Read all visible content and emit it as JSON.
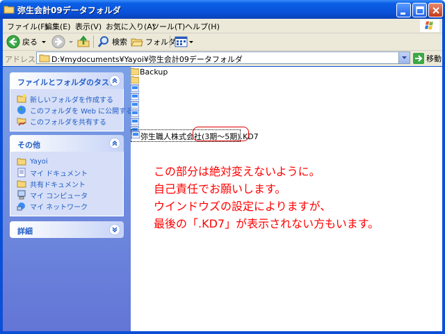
{
  "window": {
    "title": "弥生会計09データフォルダ",
    "controls": [
      "minimize",
      "maximize",
      "close"
    ]
  },
  "menubar": {
    "items": [
      "ファイル(F)",
      "編集(E)",
      "表示(V)",
      "お気に入り(A)",
      "ツール(T)",
      "ヘルプ(H)"
    ]
  },
  "toolbar": {
    "back_label": "戻る",
    "search_label": "検索",
    "folders_label": "フォルダ"
  },
  "addressbar": {
    "label": "アドレス(D)",
    "path": "D:¥mydocuments¥Yayoi¥弥生会計09データフォルダ",
    "go_label": "移動"
  },
  "taskpane": {
    "file_tasks": {
      "title": "ファイルとフォルダのタスク",
      "items": [
        "新しいフォルダを作成する",
        "このフォルダを Web に公開する",
        "このフォルダを共有する"
      ]
    },
    "other_places": {
      "title": "その他",
      "items": [
        "Yayoi",
        "マイ ドキュメント",
        "共有ドキュメント",
        "マイ コンピュータ",
        "マイ ネットワーク"
      ]
    },
    "details": {
      "title": "詳細"
    }
  },
  "files": {
    "backup_folder": "Backup",
    "selected_file": "弥生職人株式会社(3期～5期).KD7"
  },
  "annotation": {
    "lines": [
      "この部分は絶対変えないように。",
      "自己責任でお願いします。",
      "ウインドウズの設定によりますが、",
      "最後の「.KD7」が表示されない方もいます。"
    ]
  },
  "colors": {
    "titlebar": "#0a50d8",
    "taskpane": "#6375d6",
    "task_link": "#215dc6",
    "annotation": "#ff0000"
  }
}
